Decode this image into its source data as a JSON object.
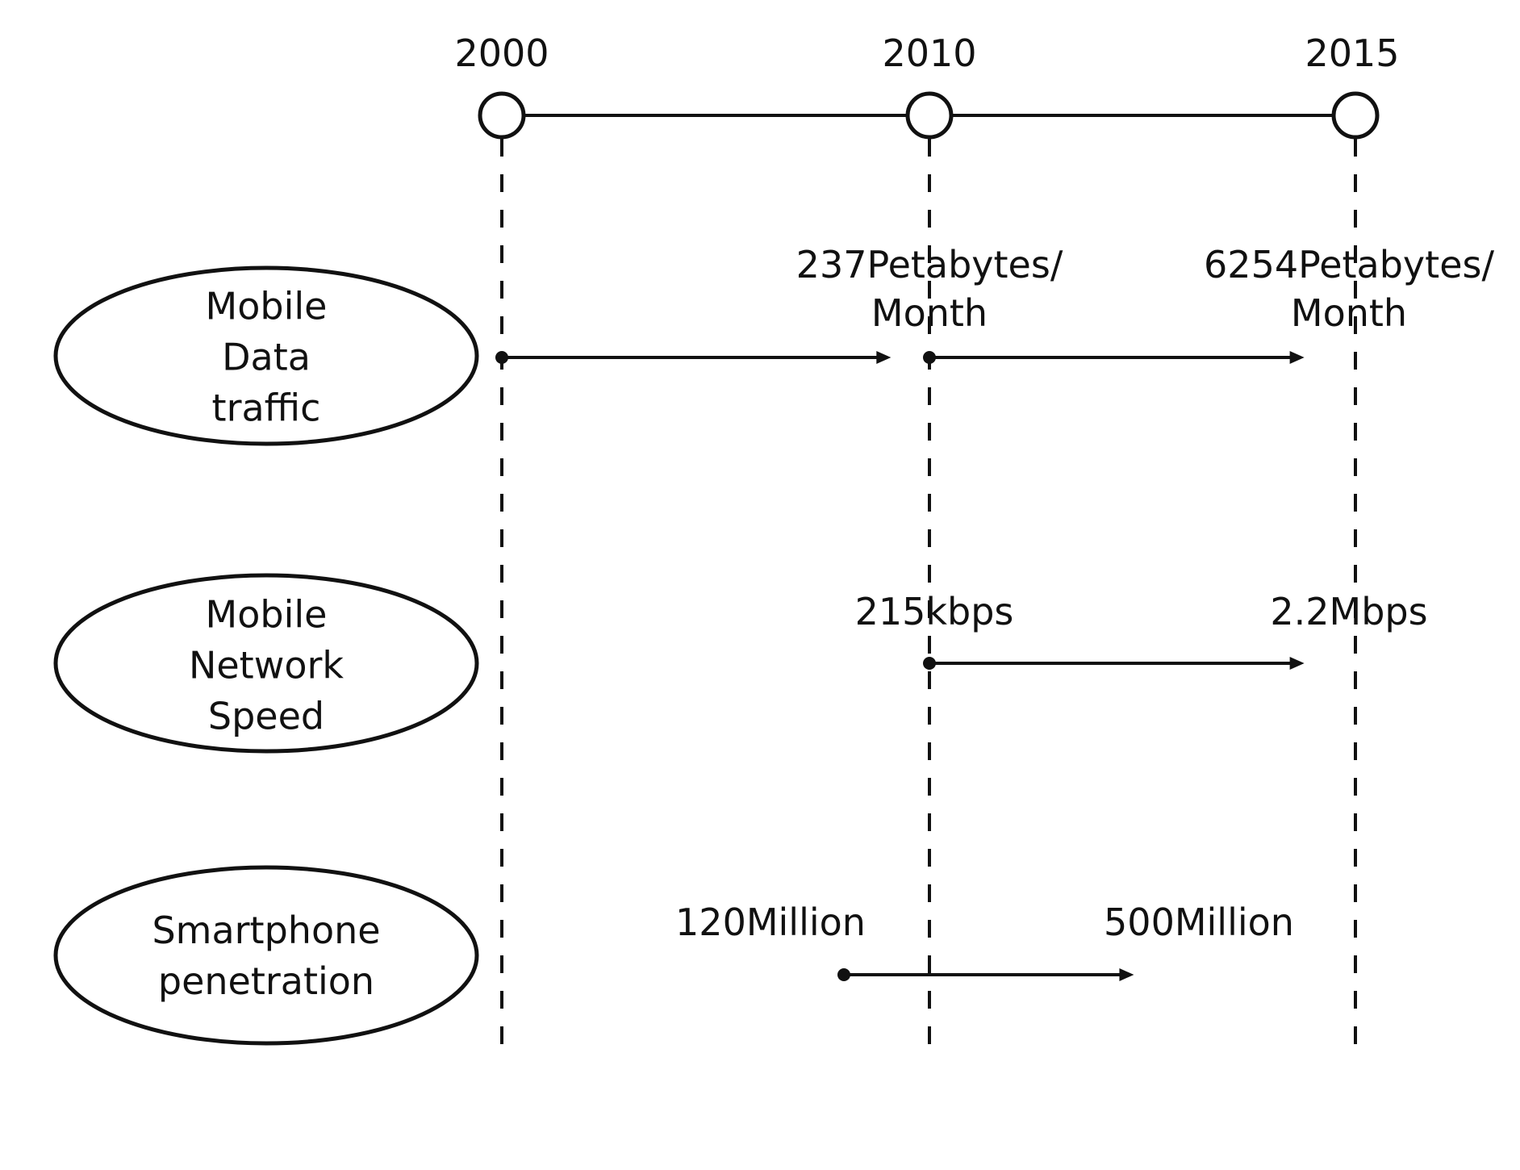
{
  "timeline": {
    "years": [
      "2000",
      "2010",
      "2015"
    ]
  },
  "rows": [
    {
      "category_lines": [
        "Mobile",
        "Data",
        "traffic"
      ],
      "values": [
        {
          "year": "2010",
          "lines": [
            "237Petabytes/",
            "Month"
          ]
        },
        {
          "year": "2015",
          "lines": [
            "6254Petabytes/",
            "Month"
          ]
        }
      ],
      "arrows": [
        {
          "from_year": 2000,
          "to_year": 2009.1
        },
        {
          "from_year": 2010,
          "to_year": 2014.4
        }
      ]
    },
    {
      "category_lines": [
        "Mobile",
        "Network",
        "Speed"
      ],
      "values": [
        {
          "year": "2010",
          "lines": [
            "215kbps"
          ]
        },
        {
          "year": "2015",
          "lines": [
            "2.2Mbps"
          ]
        }
      ],
      "arrows": [
        {
          "from_year": 2010,
          "to_year": 2014.4
        }
      ]
    },
    {
      "category_lines": [
        "Smartphone",
        "penetration"
      ],
      "values": [
        {
          "year": "2010",
          "lines": [
            "120Million"
          ]
        },
        {
          "year": "2015",
          "lines": [
            "500Million"
          ]
        }
      ],
      "arrows": [
        {
          "from_year": 2008.0,
          "to_year": 2012.4
        }
      ]
    }
  ]
}
